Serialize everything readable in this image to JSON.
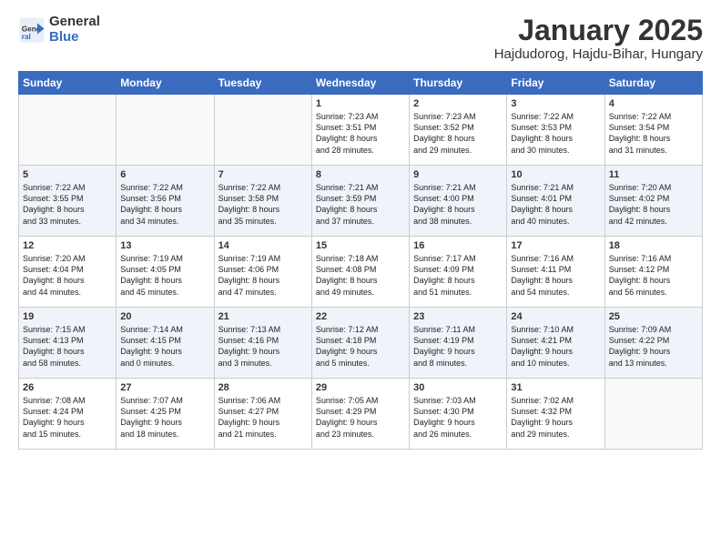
{
  "header": {
    "logo_general": "General",
    "logo_blue": "Blue",
    "month_title": "January 2025",
    "location": "Hajdudorog, Hajdu-Bihar, Hungary"
  },
  "weekdays": [
    "Sunday",
    "Monday",
    "Tuesday",
    "Wednesday",
    "Thursday",
    "Friday",
    "Saturday"
  ],
  "weeks": [
    [
      {
        "day": "",
        "info": ""
      },
      {
        "day": "",
        "info": ""
      },
      {
        "day": "",
        "info": ""
      },
      {
        "day": "1",
        "info": "Sunrise: 7:23 AM\nSunset: 3:51 PM\nDaylight: 8 hours\nand 28 minutes."
      },
      {
        "day": "2",
        "info": "Sunrise: 7:23 AM\nSunset: 3:52 PM\nDaylight: 8 hours\nand 29 minutes."
      },
      {
        "day": "3",
        "info": "Sunrise: 7:22 AM\nSunset: 3:53 PM\nDaylight: 8 hours\nand 30 minutes."
      },
      {
        "day": "4",
        "info": "Sunrise: 7:22 AM\nSunset: 3:54 PM\nDaylight: 8 hours\nand 31 minutes."
      }
    ],
    [
      {
        "day": "5",
        "info": "Sunrise: 7:22 AM\nSunset: 3:55 PM\nDaylight: 8 hours\nand 33 minutes."
      },
      {
        "day": "6",
        "info": "Sunrise: 7:22 AM\nSunset: 3:56 PM\nDaylight: 8 hours\nand 34 minutes."
      },
      {
        "day": "7",
        "info": "Sunrise: 7:22 AM\nSunset: 3:58 PM\nDaylight: 8 hours\nand 35 minutes."
      },
      {
        "day": "8",
        "info": "Sunrise: 7:21 AM\nSunset: 3:59 PM\nDaylight: 8 hours\nand 37 minutes."
      },
      {
        "day": "9",
        "info": "Sunrise: 7:21 AM\nSunset: 4:00 PM\nDaylight: 8 hours\nand 38 minutes."
      },
      {
        "day": "10",
        "info": "Sunrise: 7:21 AM\nSunset: 4:01 PM\nDaylight: 8 hours\nand 40 minutes."
      },
      {
        "day": "11",
        "info": "Sunrise: 7:20 AM\nSunset: 4:02 PM\nDaylight: 8 hours\nand 42 minutes."
      }
    ],
    [
      {
        "day": "12",
        "info": "Sunrise: 7:20 AM\nSunset: 4:04 PM\nDaylight: 8 hours\nand 44 minutes."
      },
      {
        "day": "13",
        "info": "Sunrise: 7:19 AM\nSunset: 4:05 PM\nDaylight: 8 hours\nand 45 minutes."
      },
      {
        "day": "14",
        "info": "Sunrise: 7:19 AM\nSunset: 4:06 PM\nDaylight: 8 hours\nand 47 minutes."
      },
      {
        "day": "15",
        "info": "Sunrise: 7:18 AM\nSunset: 4:08 PM\nDaylight: 8 hours\nand 49 minutes."
      },
      {
        "day": "16",
        "info": "Sunrise: 7:17 AM\nSunset: 4:09 PM\nDaylight: 8 hours\nand 51 minutes."
      },
      {
        "day": "17",
        "info": "Sunrise: 7:16 AM\nSunset: 4:11 PM\nDaylight: 8 hours\nand 54 minutes."
      },
      {
        "day": "18",
        "info": "Sunrise: 7:16 AM\nSunset: 4:12 PM\nDaylight: 8 hours\nand 56 minutes."
      }
    ],
    [
      {
        "day": "19",
        "info": "Sunrise: 7:15 AM\nSunset: 4:13 PM\nDaylight: 8 hours\nand 58 minutes."
      },
      {
        "day": "20",
        "info": "Sunrise: 7:14 AM\nSunset: 4:15 PM\nDaylight: 9 hours\nand 0 minutes."
      },
      {
        "day": "21",
        "info": "Sunrise: 7:13 AM\nSunset: 4:16 PM\nDaylight: 9 hours\nand 3 minutes."
      },
      {
        "day": "22",
        "info": "Sunrise: 7:12 AM\nSunset: 4:18 PM\nDaylight: 9 hours\nand 5 minutes."
      },
      {
        "day": "23",
        "info": "Sunrise: 7:11 AM\nSunset: 4:19 PM\nDaylight: 9 hours\nand 8 minutes."
      },
      {
        "day": "24",
        "info": "Sunrise: 7:10 AM\nSunset: 4:21 PM\nDaylight: 9 hours\nand 10 minutes."
      },
      {
        "day": "25",
        "info": "Sunrise: 7:09 AM\nSunset: 4:22 PM\nDaylight: 9 hours\nand 13 minutes."
      }
    ],
    [
      {
        "day": "26",
        "info": "Sunrise: 7:08 AM\nSunset: 4:24 PM\nDaylight: 9 hours\nand 15 minutes."
      },
      {
        "day": "27",
        "info": "Sunrise: 7:07 AM\nSunset: 4:25 PM\nDaylight: 9 hours\nand 18 minutes."
      },
      {
        "day": "28",
        "info": "Sunrise: 7:06 AM\nSunset: 4:27 PM\nDaylight: 9 hours\nand 21 minutes."
      },
      {
        "day": "29",
        "info": "Sunrise: 7:05 AM\nSunset: 4:29 PM\nDaylight: 9 hours\nand 23 minutes."
      },
      {
        "day": "30",
        "info": "Sunrise: 7:03 AM\nSunset: 4:30 PM\nDaylight: 9 hours\nand 26 minutes."
      },
      {
        "day": "31",
        "info": "Sunrise: 7:02 AM\nSunset: 4:32 PM\nDaylight: 9 hours\nand 29 minutes."
      },
      {
        "day": "",
        "info": ""
      }
    ]
  ]
}
